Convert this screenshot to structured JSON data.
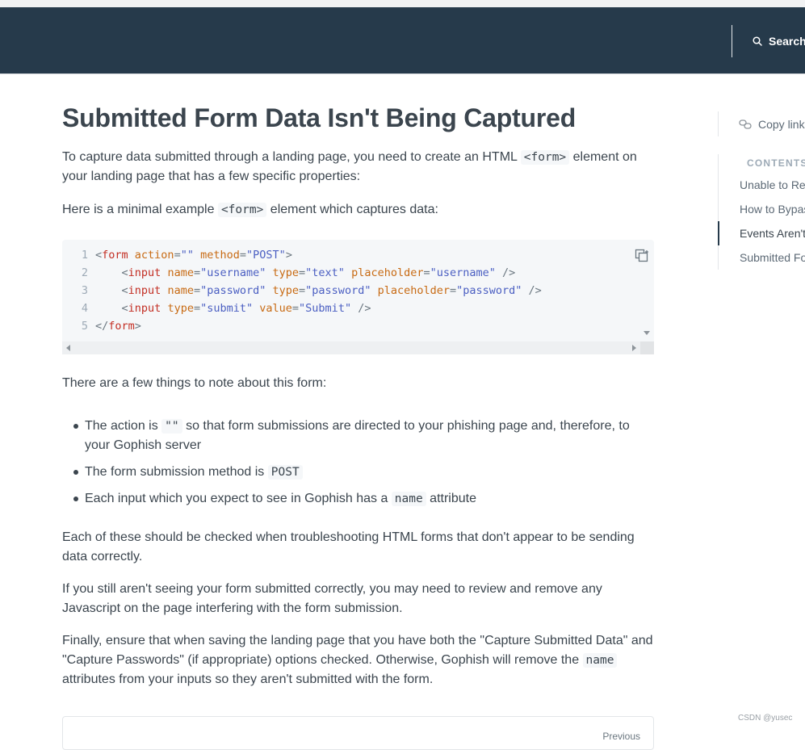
{
  "header": {
    "search_label": "Search"
  },
  "article": {
    "title": "Submitted Form Data Isn't Being Captured",
    "intro": {
      "before": "To capture data submitted through a landing page, you need to create an HTML ",
      "code": "<form>",
      "after": " element on your landing page that has a few specific properties:"
    },
    "example": {
      "before": "Here is a minimal example ",
      "code": "<form>",
      "after": " element which captures data:"
    },
    "code_lines": [
      {
        "num": "1",
        "indent": "",
        "tag": "form",
        "attrs": [
          {
            "name": "action",
            "value": "\"\""
          },
          {
            "name": "method",
            "value": "\"POST\""
          }
        ],
        "close": ">"
      },
      {
        "num": "2",
        "indent": "    ",
        "tag": "input",
        "attrs": [
          {
            "name": "name",
            "value": "\"username\""
          },
          {
            "name": "type",
            "value": "\"text\""
          },
          {
            "name": "placeholder",
            "value": "\"username\""
          }
        ],
        "close": " />"
      },
      {
        "num": "3",
        "indent": "    ",
        "tag": "input",
        "attrs": [
          {
            "name": "name",
            "value": "\"password\""
          },
          {
            "name": "type",
            "value": "\"password\""
          },
          {
            "name": "placeholder",
            "value": "\"password\""
          }
        ],
        "close": " />"
      },
      {
        "num": "4",
        "indent": "    ",
        "tag": "input",
        "attrs": [
          {
            "name": "type",
            "value": "\"submit\""
          },
          {
            "name": "value",
            "value": "\"Submit\""
          }
        ],
        "close": " />"
      },
      {
        "num": "5",
        "indent": "",
        "open": "</",
        "tag": "form",
        "attrs": [],
        "close": ">"
      }
    ],
    "notes_intro": "There are a few things to note about this form:",
    "notes": [
      {
        "before": "The action is ",
        "code": "\"\"",
        "after": " so that form submissions are directed to your phishing page and, therefore, to your Gophish server"
      },
      {
        "before": "The form submission method is ",
        "code": "POST",
        "after": ""
      },
      {
        "before": "Each input which you expect to see in Gophish has a ",
        "code": "name",
        "after": " attribute"
      }
    ],
    "troubleshoot": "Each of these should be checked when troubleshooting HTML forms that don't appear to be sending data correctly.",
    "javascript_note": "If you still aren't seeing your form submitted correctly, you may need to review and remove any Javascript on the page interfering with the form submission.",
    "final": {
      "before": "Finally, ensure that when saving the landing page that you have both the \"Capture Submitted Data\" and \"Capture Passwords\" (if appropriate) options checked. Otherwise, Gophish will remove the ",
      "code": "name",
      "after": " attributes from your inputs so they aren't submitted with the form."
    },
    "footer_nav": {
      "previous_label": "Previous"
    }
  },
  "sidebar": {
    "copy_link_label": "Copy link",
    "toc_title": "CONTENTS",
    "toc_items": [
      {
        "label": "Unable to Reach"
      },
      {
        "label": "How to Bypass"
      },
      {
        "label": "Events Aren't"
      },
      {
        "label": "Submitted Form"
      }
    ],
    "active_index": 2
  },
  "watermark": "CSDN @yusec",
  "colors": {
    "header_bg": "#263a4b",
    "code_bg": "#f5f7f9",
    "tag": "#c32f24",
    "attr": "#c86b14",
    "string": "#4b5fc2"
  }
}
